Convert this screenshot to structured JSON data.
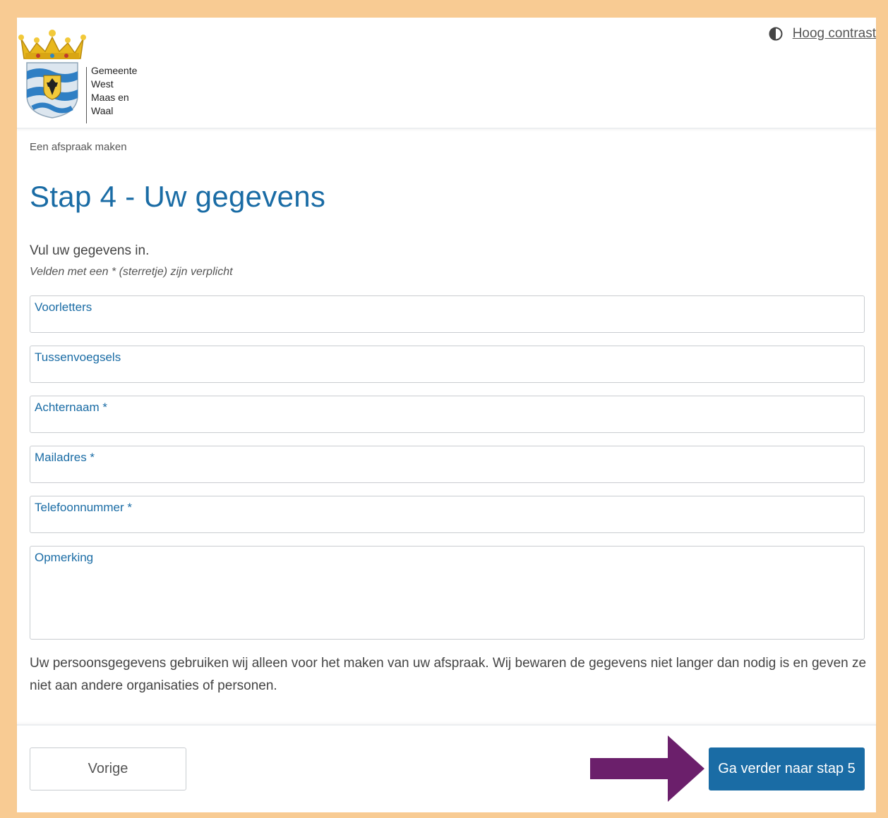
{
  "header": {
    "logo_text_lines": [
      "Gemeente",
      "West",
      "Maas en",
      "Waal"
    ],
    "contrast_label": "Hoog contrast",
    "contrast_icon": "half-circle-contrast-icon"
  },
  "breadcrumb": "Een afspraak maken",
  "title": "Stap 4 - Uw gegevens",
  "intro": "Vul uw gegevens in.",
  "required_note": "Velden met een * (sterretje) zijn verplicht",
  "fields": [
    {
      "label": "Voorletters",
      "value": ""
    },
    {
      "label": "Tussenvoegsels",
      "value": ""
    },
    {
      "label": "Achternaam *",
      "value": ""
    },
    {
      "label": "Mailadres *",
      "value": ""
    },
    {
      "label": "Telefoonnummer *",
      "value": ""
    },
    {
      "label": "Opmerking",
      "value": ""
    }
  ],
  "privacy_text": "Uw persoonsgegevens gebruiken wij alleen voor het maken van uw afspraak. Wij bewaren de gegevens niet langer dan nodig is en geven ze niet aan andere organisaties of personen.",
  "footer": {
    "prev_label": "Vorige",
    "next_label": "Ga verder naar stap 5"
  },
  "colors": {
    "accent": "#1a6ca5",
    "border_frame": "#f8cb93",
    "annotation_arrow": "#6b1f6b"
  }
}
